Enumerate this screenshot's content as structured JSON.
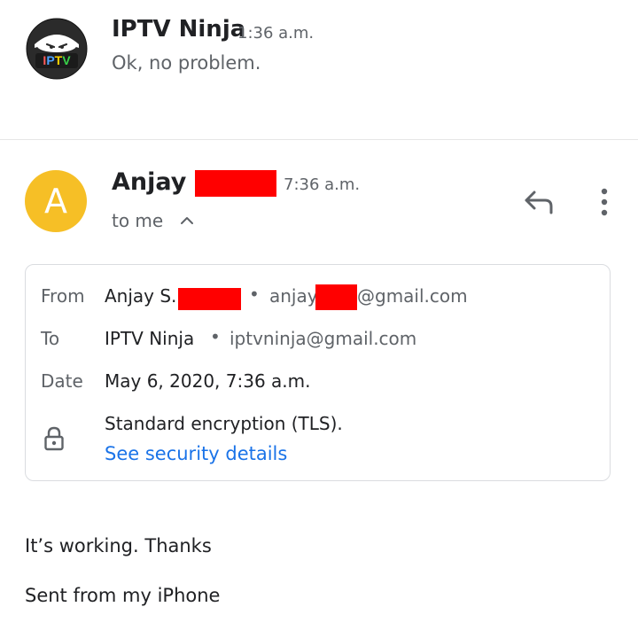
{
  "thread": {
    "previous": {
      "avatar_text": "IPTV",
      "sender": "IPTV Ninja",
      "time": "1:36 a.m.",
      "snippet": "Ok, no problem."
    },
    "current": {
      "avatar_letter": "A",
      "sender": "Anjay S",
      "time": "7:36 a.m.",
      "recipient_line": "to me"
    }
  },
  "details": {
    "from_label": "From",
    "from_name": "Anjay S.",
    "from_email_prefix": "anjay",
    "from_email_suffix": "@gmail.com",
    "to_label": "To",
    "to_name": "IPTV Ninja",
    "to_email": "iptvninja@gmail.com",
    "date_label": "Date",
    "date_value": "May 6, 2020, 7:36 a.m.",
    "encryption": "Standard encryption (TLS).",
    "security_link": "See security details",
    "separator": "•"
  },
  "body": {
    "line1": "It’s working. Thanks",
    "line2": "Sent from my iPhone"
  },
  "icons": {
    "reply": "reply-icon",
    "more": "more-vert-icon",
    "expand": "chevron-up-icon",
    "lock": "lock-icon"
  },
  "colors": {
    "avatar_yellow": "#f6bf26",
    "link_blue": "#1a73e8",
    "redaction": "#ff0000"
  }
}
